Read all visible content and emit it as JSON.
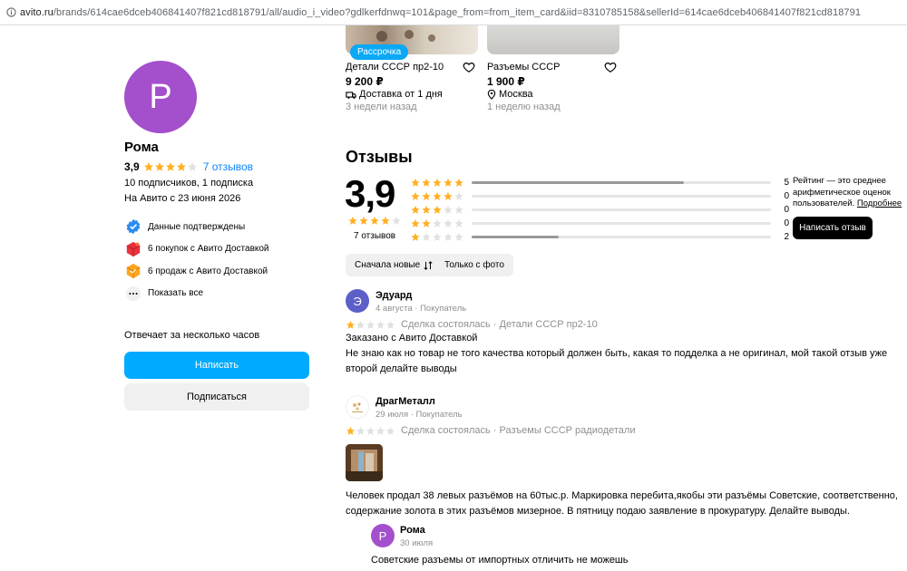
{
  "browser": {
    "url_host": "avito.ru",
    "url_path": "/brands/614cae6dceb406841407f821cd818791/all/audio_i_video?gdlkerfdnwq=101&page_from=from_item_card&iid=831078515​8&sellerId=614cae6dceb406841407f821cd818791"
  },
  "profile": {
    "avatar_letter": "Р",
    "name": "Рома",
    "rating": "3,9",
    "reviews_link": "7 отзывов",
    "subscribers": "10 подписчиков, 1 подписка",
    "since": "На Авито с 23 июня 2026",
    "badges": [
      {
        "label": "Данные подтверждены",
        "icon": "verified-shield-icon"
      },
      {
        "label": "6 покупок с Авито Доставкой",
        "icon": "delivery-cube-red-icon"
      },
      {
        "label": "6 продаж с Авито Доставкой",
        "icon": "delivery-cube-orange-icon"
      },
      {
        "label": "Показать все",
        "icon": "more-dots-icon"
      }
    ],
    "answers": "Отвечает за несколько часов",
    "write_button": "Написать",
    "subscribe_button": "Подписаться"
  },
  "items": [
    {
      "badge": "Рассрочка",
      "title": "Детали СССР пр2-10",
      "price": "9 200 ₽",
      "meta": "Доставка от 1 дня",
      "meta_icon": "delivery-box-icon",
      "date": "3 недели назад"
    },
    {
      "badge": "",
      "title": "Разъемы СССР",
      "price": "1 900 ₽",
      "meta": "Москва",
      "meta_icon": "location-pin-icon",
      "date": "1 неделю назад"
    }
  ],
  "reviews_section": {
    "title": "Отзывы",
    "rating": "3,9",
    "count": "7 отзывов",
    "distribution": [
      {
        "stars": 5,
        "count": "5",
        "fraction": 0.71
      },
      {
        "stars": 4,
        "count": "0",
        "fraction": 0
      },
      {
        "stars": 3,
        "count": "0",
        "fraction": 0
      },
      {
        "stars": 2,
        "count": "0",
        "fraction": 0
      },
      {
        "stars": 1,
        "count": "2",
        "fraction": 0.29
      }
    ],
    "note": "Рейтинг — это среднее арифметическое оценок пользователей.",
    "note_link": "Подробнее",
    "write_review": "Написать отзыв",
    "filters": [
      "Сначала новые",
      "Только с фото"
    ]
  },
  "reviews": [
    {
      "avatar_letter": "Э",
      "avatar_color": "#5b5fc7",
      "name": "Эдуард",
      "sub": "4 августа · Покупатель",
      "deal": "Сделка состоялась · Детали СССР пр2-10",
      "ordered": "Заказано с Авито Доставкой",
      "text": "Не знаю как но товар не того качества который должен быть, какая то подделка а не оригинал, мой такой отзыв уже второй делайте выводы"
    },
    {
      "name": "ДрагМеталл",
      "sub": "29 июля · Покупатель",
      "deal": "Сделка состоялась · Разъемы СССР радиодетали",
      "text": "Человек продал 38 левых разъёмов на 60тыс.р. Маркировка перебита,якобы эти разъёмы Советские, соответственно, содержание золота в этих разъёмов мизерное. В пятницу подаю заявление в прокуратуру. Делайте выводы."
    }
  ],
  "reply": {
    "avatar_letter": "Р",
    "name": "Рома",
    "date": "30 июля",
    "text": "Советские разъемы от импортных отличить не можешь"
  },
  "colors": {
    "accent": "#00aaff",
    "star": "#ffb021",
    "star_empty": "#e0e0e0",
    "avatar": "#a44fcb"
  }
}
